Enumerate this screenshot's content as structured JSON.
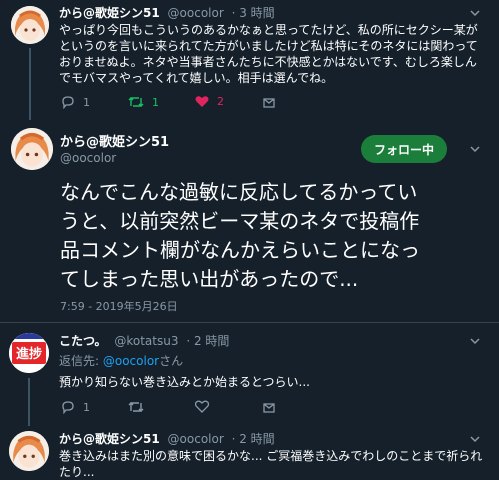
{
  "tweet1": {
    "name": "から@歌姫シン51",
    "handle": "@oocolor",
    "time": "· 3 時間",
    "lines": [
      "やっぱり今回もこういうのあるかなぁと思ってたけど、私の所にセクシー某が",
      "というのを言いに来られてた方がいましたけど私は特にそのネタには関わって",
      "おりませぬよ。ネタや当事者さんたちに不快感とかはないです、むしろ楽しん",
      "でモバマスやってくれて嬉しい。相手は選んでね。"
    ],
    "reply_count": "1",
    "retweet_count": "1",
    "like_count": "2"
  },
  "main": {
    "name": "から@歌姫シン51",
    "handle": "@oocolor",
    "follow_label": "フォロー中",
    "lines": [
      "なんでこんな過敏に反応してるかってい",
      "うと、以前突然ビーマ某のネタで投稿作",
      "品コメント欄がなんかえらいことになっ",
      "てしまった思い出があったので..."
    ],
    "timestamp": "7:59 - 2019年5月26日"
  },
  "reply1": {
    "name": "こたつ。",
    "handle": "@kotatsu3",
    "time": "· 2 時間",
    "reply_to_prefix": "返信先: ",
    "reply_to_user": "@oocolor",
    "reply_to_suffix": "さん",
    "text": "預かり知らない巻き込みとか始まるとつらい...",
    "reply_count": "1",
    "avatar_text": "進捗"
  },
  "reply2": {
    "name": "から@歌姫シン51",
    "handle": "@oocolor",
    "time": "· 2 時間",
    "lines": [
      "巻き込みはまた別の意味で困るかな... ご冥福巻き込みでわしのことまで祈られ",
      "たり..."
    ]
  },
  "colors": {
    "background": "#15202b",
    "muted": "#8899a6",
    "link": "#1da1f2",
    "retweet": "#17bf63",
    "like": "#e0245e",
    "follow": "#1b7f3b"
  },
  "icons": [
    "reply-icon",
    "retweet-icon",
    "like-icon",
    "share-icon",
    "chevron-down-icon"
  ]
}
